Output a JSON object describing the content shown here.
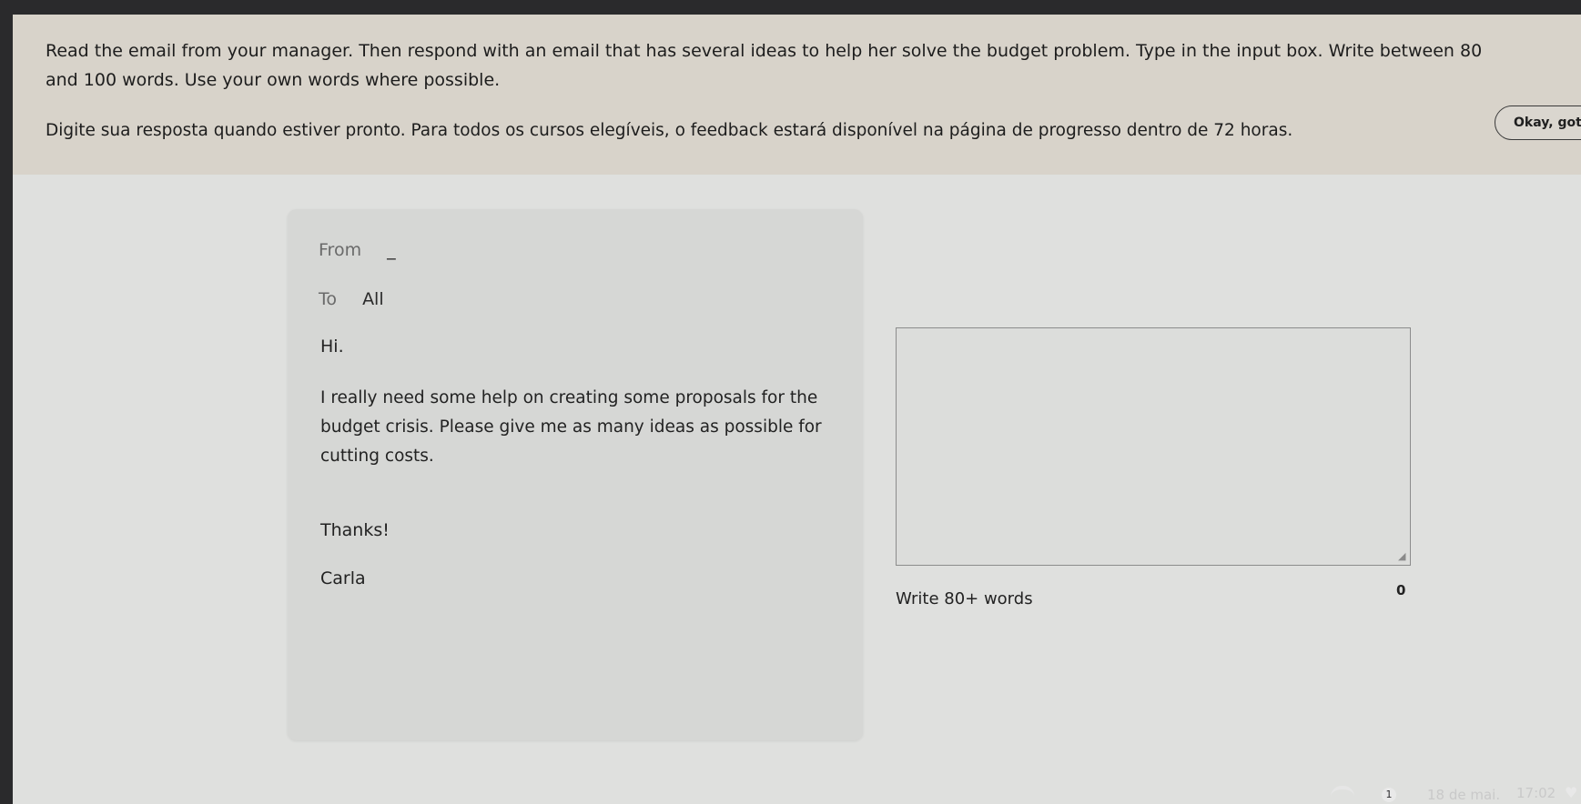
{
  "instructions": {
    "english": "Read the email from your manager. Then respond with an email that has several ideas to help her solve the budget problem. Type in the input box. Write between 80 and 100 words. Use your own words where possible.",
    "portuguese": "Digite sua resposta quando estiver pronto. Para todos os cursos elegíveis, o feedback estará disponível na página de progresso dentro de 72 horas.",
    "okay_button": "Okay, got it"
  },
  "email": {
    "from_label": "From",
    "from_value": "_",
    "to_label": "To",
    "to_value": "All",
    "greeting": "Hi.",
    "body": "I really need some help on creating some proposals for the budget crisis. Please give me as many ideas as possible for cutting costs.",
    "closing": "Thanks!",
    "signature": "Carla"
  },
  "response": {
    "value": "",
    "hint": "Write 80+ words",
    "word_count": "0"
  },
  "taskbar": {
    "wifi_icon": "wifi-icon",
    "notification_icon": "notification-icon",
    "notification_badge": "1",
    "date": "18 de mai.",
    "time": "17:02",
    "status_icon": "heart-icon"
  }
}
